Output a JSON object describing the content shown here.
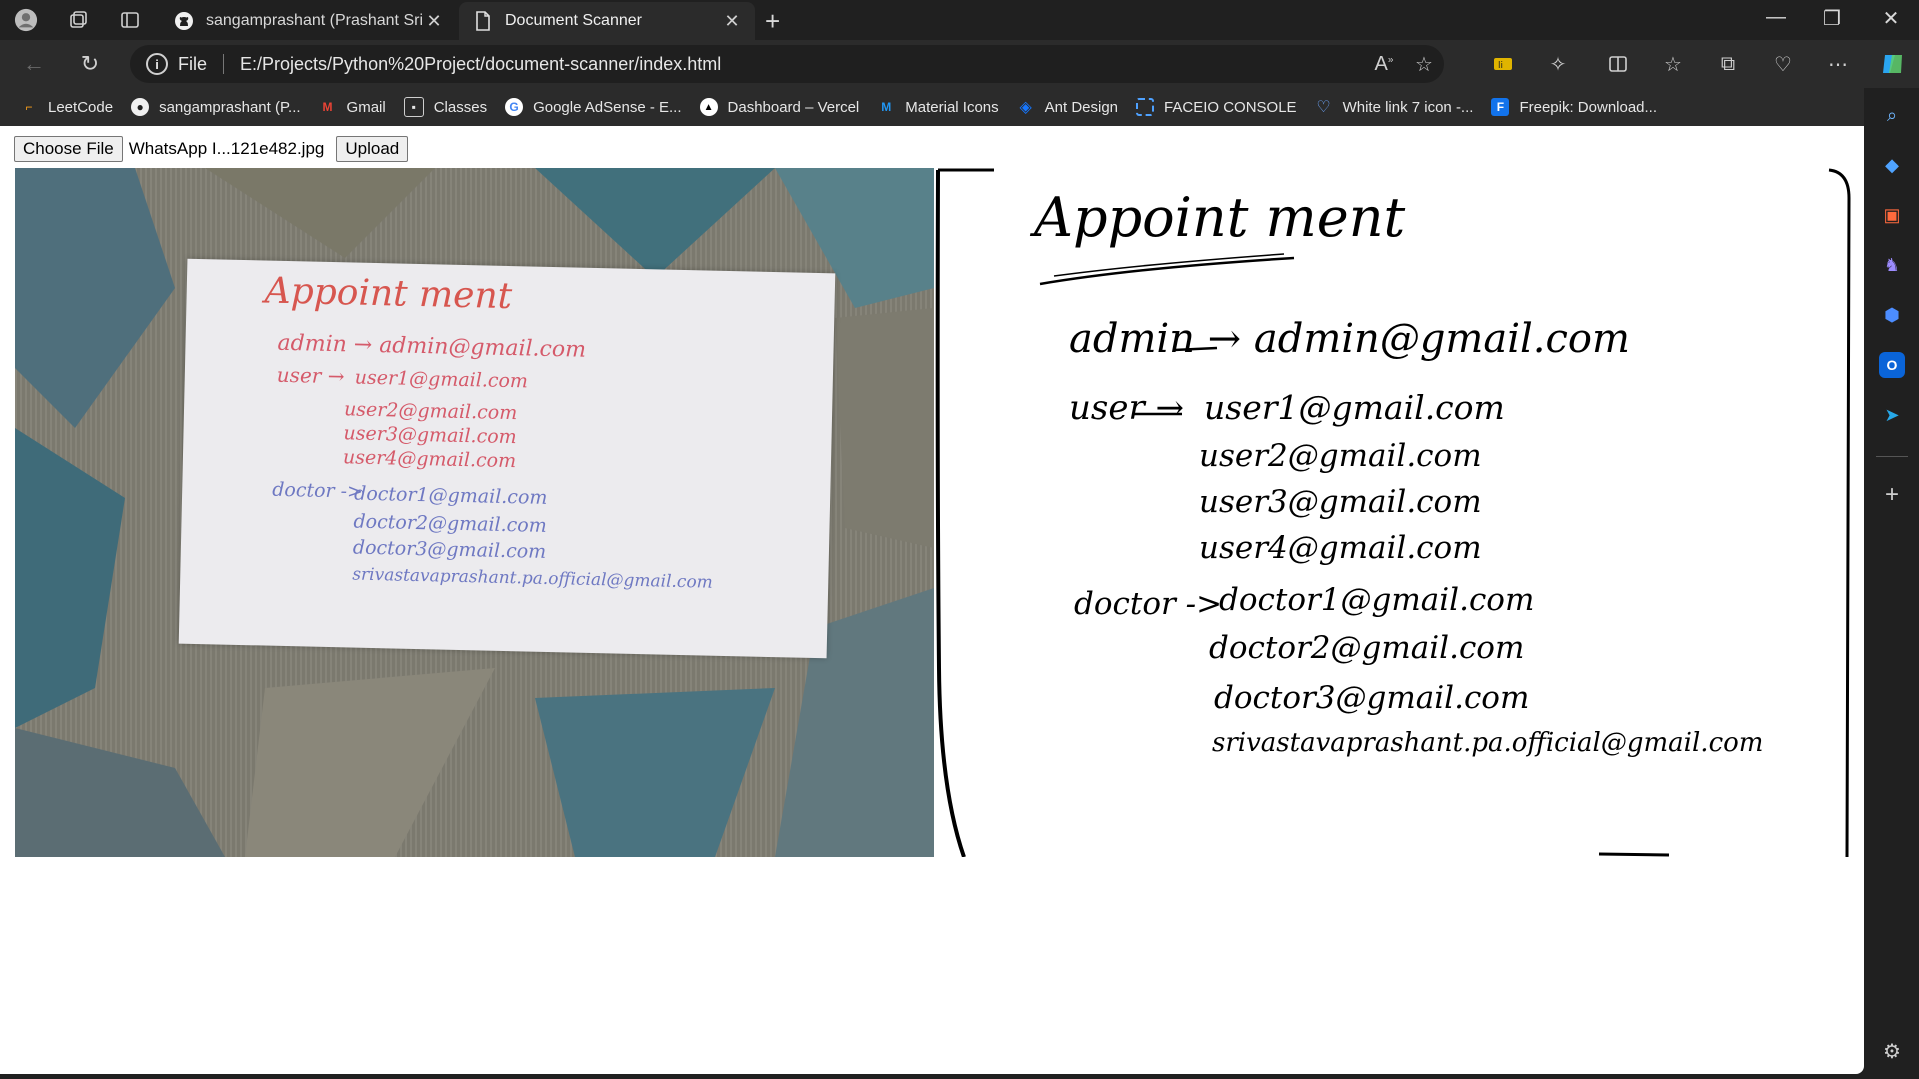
{
  "browser": {
    "tabs": [
      {
        "title": "sangamprashant (Prashant Srivas",
        "favicon": "github-icon",
        "active": false
      },
      {
        "title": "Document Scanner",
        "favicon": "document-icon",
        "active": true
      }
    ],
    "address": {
      "protocol": "File",
      "url": "E:/Projects/Python%20Project/document-scanner/index.html"
    },
    "bookmarks": [
      {
        "label": "LeetCode",
        "icon": "leetcode-icon",
        "color": "#f89f1b"
      },
      {
        "label": "sangamprashant (P...",
        "icon": "github-icon",
        "color": "#ffffff"
      },
      {
        "label": "Gmail",
        "icon": "gmail-icon",
        "color": "#ea4335"
      },
      {
        "label": "Classes",
        "icon": "classes-icon",
        "color": "#cfcfcf"
      },
      {
        "label": "Google AdSense - E...",
        "icon": "google-icon",
        "color": "#4285f4"
      },
      {
        "label": "Dashboard – Vercel",
        "icon": "vercel-icon",
        "color": "#ffffff"
      },
      {
        "label": "Material Icons",
        "icon": "material-icons-icon",
        "color": "#2196f3"
      },
      {
        "label": "Ant Design",
        "icon": "ant-design-icon",
        "color": "#1677ff"
      },
      {
        "label": "FACEIO CONSOLE",
        "icon": "faceio-icon",
        "color": "#4ea1ff"
      },
      {
        "label": "White link 7 icon -...",
        "icon": "heart-icon",
        "color": "#6fa8ff"
      },
      {
        "label": "Freepik: Download...",
        "icon": "freepik-icon",
        "color": "#1273eb"
      }
    ]
  },
  "page": {
    "choose_file_label": "Choose File",
    "file_name": "WhatsApp I...121e482.jpg",
    "upload_label": "Upload"
  },
  "document_text": {
    "title": "Appoint ment",
    "admin_line": "admin → admin@gmail.com",
    "user_label": "user →",
    "users": [
      "user1@gmail.com",
      "user2@gmail.com",
      "user3@gmail.com",
      "user4@gmail.com"
    ],
    "doctor_label": "doctor ->",
    "doctors": [
      "doctor1@gmail.com",
      "doctor2@gmail.com",
      "doctor3@gmail.com",
      "srivastavaprashant.pa.official@gmail.com"
    ]
  }
}
